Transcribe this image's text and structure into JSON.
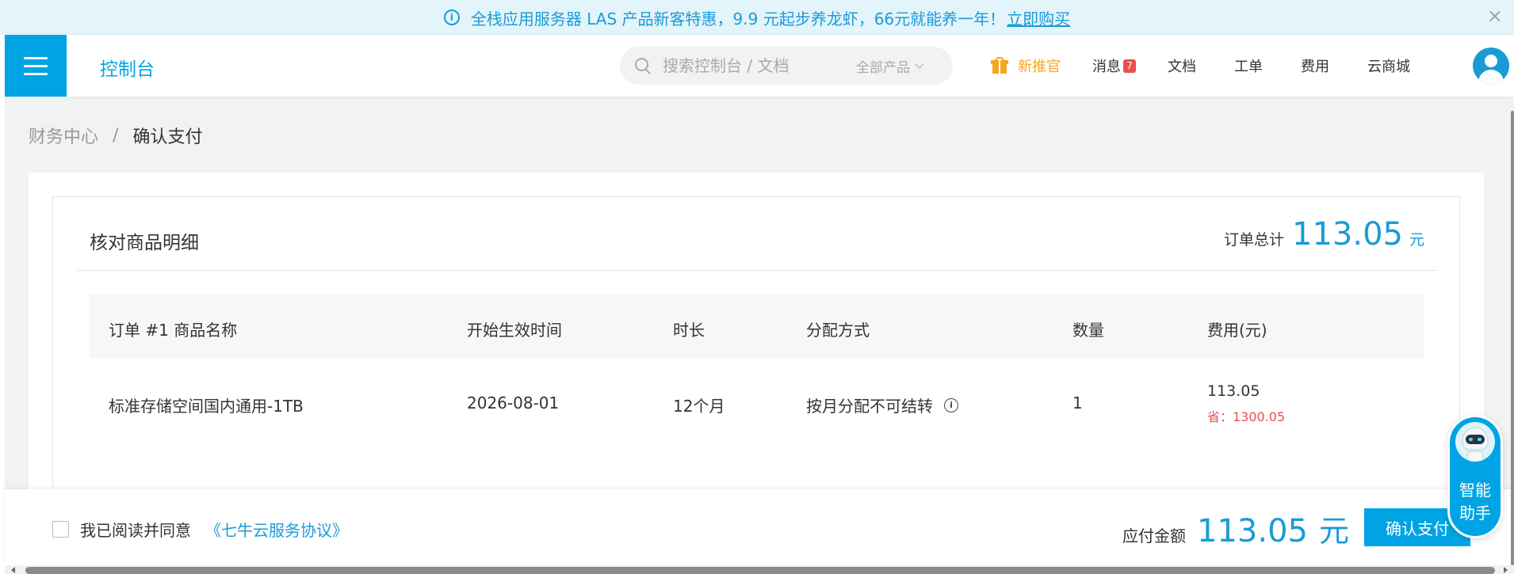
{
  "banner": {
    "text": "全栈应用服务器 LAS 产品新客特惠，9.9 元起步养龙虾，66元就能养一年！",
    "link": "立即购买",
    "close": "×"
  },
  "nav": {
    "console_title": "控制台",
    "search_placeholder": "搜索控制台 / 文档",
    "product_filter": "全部产品",
    "items": {
      "new": "新推官",
      "messages": "消息",
      "messages_badge": "7",
      "docs": "文档",
      "tickets": "工单",
      "billing": "费用",
      "marketplace": "云商城"
    }
  },
  "breadcrumb": {
    "parent": "财务中心",
    "separator": "/",
    "current": "确认支付"
  },
  "card": {
    "title": "核对商品明细",
    "order_total_label": "订单总计",
    "order_total_amount": "113.05",
    "order_total_unit": "元"
  },
  "table": {
    "headers": [
      "订单 #1 商品名称",
      "开始生效时间",
      "时长",
      "分配方式",
      "数量",
      "费用(元)"
    ],
    "rows": [
      {
        "name": "标准存储空间国内通用-1TB",
        "start": "2026-08-01",
        "duration": "12个月",
        "allocation": "按月分配不可结转",
        "quantity": "1",
        "fee": "113.05",
        "saved": "省：1300.05"
      }
    ]
  },
  "footer": {
    "agree_text": "我已阅读并同意",
    "agree_link": "《七牛云服务协议》",
    "payable_label": "应付金额",
    "payable_amount": "113.05",
    "payable_unit": "元",
    "confirm_button": "确认支付"
  },
  "assistant": {
    "label": "智能助手"
  },
  "colors": {
    "primary": "#00a4e4",
    "accent_blue": "#1a9bd7",
    "warning_orange": "#f5a623",
    "danger_red": "#e8504c"
  }
}
